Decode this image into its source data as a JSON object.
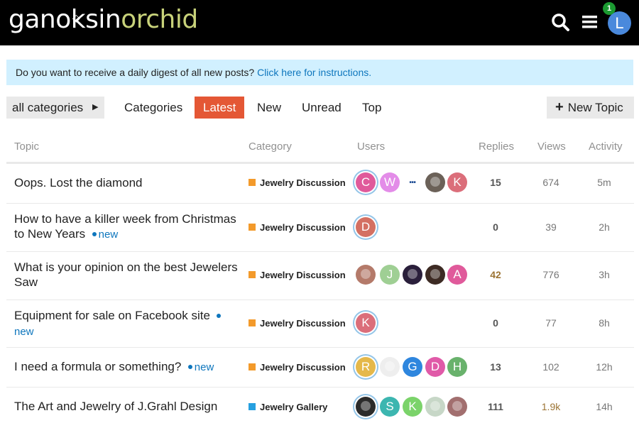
{
  "header": {
    "logo_part1": "ganoksin",
    "logo_part2": "orchid",
    "notification_count": "1",
    "user_initial": "L",
    "icons": [
      "diamond-icon",
      "search-icon",
      "hamburger-menu-icon"
    ]
  },
  "banner": {
    "text": "Do you want to receive a daily digest of all new posts?",
    "link": "Click here for instructions."
  },
  "nav": {
    "category_dropdown": "all categories",
    "tabs": [
      "Categories",
      "Latest",
      "New",
      "Unread",
      "Top"
    ],
    "active_tab": "Latest",
    "new_topic": "New Topic"
  },
  "columns": {
    "topic": "Topic",
    "category": "Category",
    "users": "Users",
    "replies": "Replies",
    "views": "Views",
    "activity": "Activity"
  },
  "new_badge": "new",
  "colors": {
    "accent": "#e45735",
    "link": "#0e76bd",
    "banner_bg": "#d1f0ff",
    "jewelry_discussion": "#f39a2b",
    "jewelry_gallery": "#26a0e0",
    "hot_count": "#9c7434"
  },
  "topics": [
    {
      "title": "Oops. Lost the diamond",
      "is_new": false,
      "category": "Jewelry Discussion",
      "replies": "15",
      "views": "674",
      "activity": "5m",
      "avatars": [
        {
          "letter": "C",
          "color": "#e05a9b",
          "ring": true
        },
        {
          "letter": "W",
          "color": "#e38ce8"
        },
        {
          "letter": "",
          "color": "#ffffff",
          "kind": "logo-text"
        },
        {
          "letter": "",
          "color": "#6b6158",
          "kind": "photo"
        },
        {
          "letter": "K",
          "color": "#db6e7a"
        }
      ]
    },
    {
      "title": "How to have a killer week from Christmas to New Years",
      "is_new": true,
      "category": "Jewelry Discussion",
      "replies": "0",
      "views": "39",
      "activity": "2h",
      "avatars": [
        {
          "letter": "D",
          "color": "#d47062",
          "ring": true
        }
      ]
    },
    {
      "title": "What is your opinion on the best Jewelers Saw",
      "is_new": false,
      "category": "Jewelry Discussion",
      "replies": "42",
      "views": "776",
      "activity": "3h",
      "hot_replies": true,
      "avatars": [
        {
          "letter": "",
          "color": "#b47a6a",
          "kind": "photo"
        },
        {
          "letter": "J",
          "color": "#9fcf94"
        },
        {
          "letter": "",
          "color": "#2a1f3b",
          "kind": "photo"
        },
        {
          "letter": "",
          "color": "#3d2b24",
          "kind": "photo"
        },
        {
          "letter": "A",
          "color": "#e05a9b"
        }
      ]
    },
    {
      "title": "Equipment for sale on Facebook site",
      "is_new": true,
      "category": "Jewelry Discussion",
      "replies": "0",
      "views": "77",
      "activity": "8h",
      "avatars": [
        {
          "letter": "K",
          "color": "#db6e7a",
          "ring": true
        }
      ]
    },
    {
      "title": "I need a formula or something?",
      "is_new": true,
      "category": "Jewelry Discussion",
      "replies": "13",
      "views": "102",
      "activity": "12h",
      "avatars": [
        {
          "letter": "R",
          "color": "#e5b84a",
          "ring": true
        },
        {
          "letter": "",
          "color": "#eeeeee",
          "kind": "photo"
        },
        {
          "letter": "G",
          "color": "#2e86de"
        },
        {
          "letter": "D",
          "color": "#e05aa8"
        },
        {
          "letter": "H",
          "color": "#69b26c"
        }
      ]
    },
    {
      "title": "The Art and Jewelry of J.Grahl Design",
      "is_new": false,
      "category": "Jewelry Gallery",
      "replies": "111",
      "views": "1.9k",
      "activity": "14h",
      "hot_views": true,
      "avatars": [
        {
          "letter": "",
          "color": "#2b2b2b",
          "kind": "photo",
          "ring": true
        },
        {
          "letter": "S",
          "color": "#3cb6b0"
        },
        {
          "letter": "K",
          "color": "#7bd36a"
        },
        {
          "letter": "",
          "color": "#c7d7c7",
          "kind": "photo"
        },
        {
          "letter": "",
          "color": "#a26f6f",
          "kind": "photo"
        }
      ]
    }
  ]
}
